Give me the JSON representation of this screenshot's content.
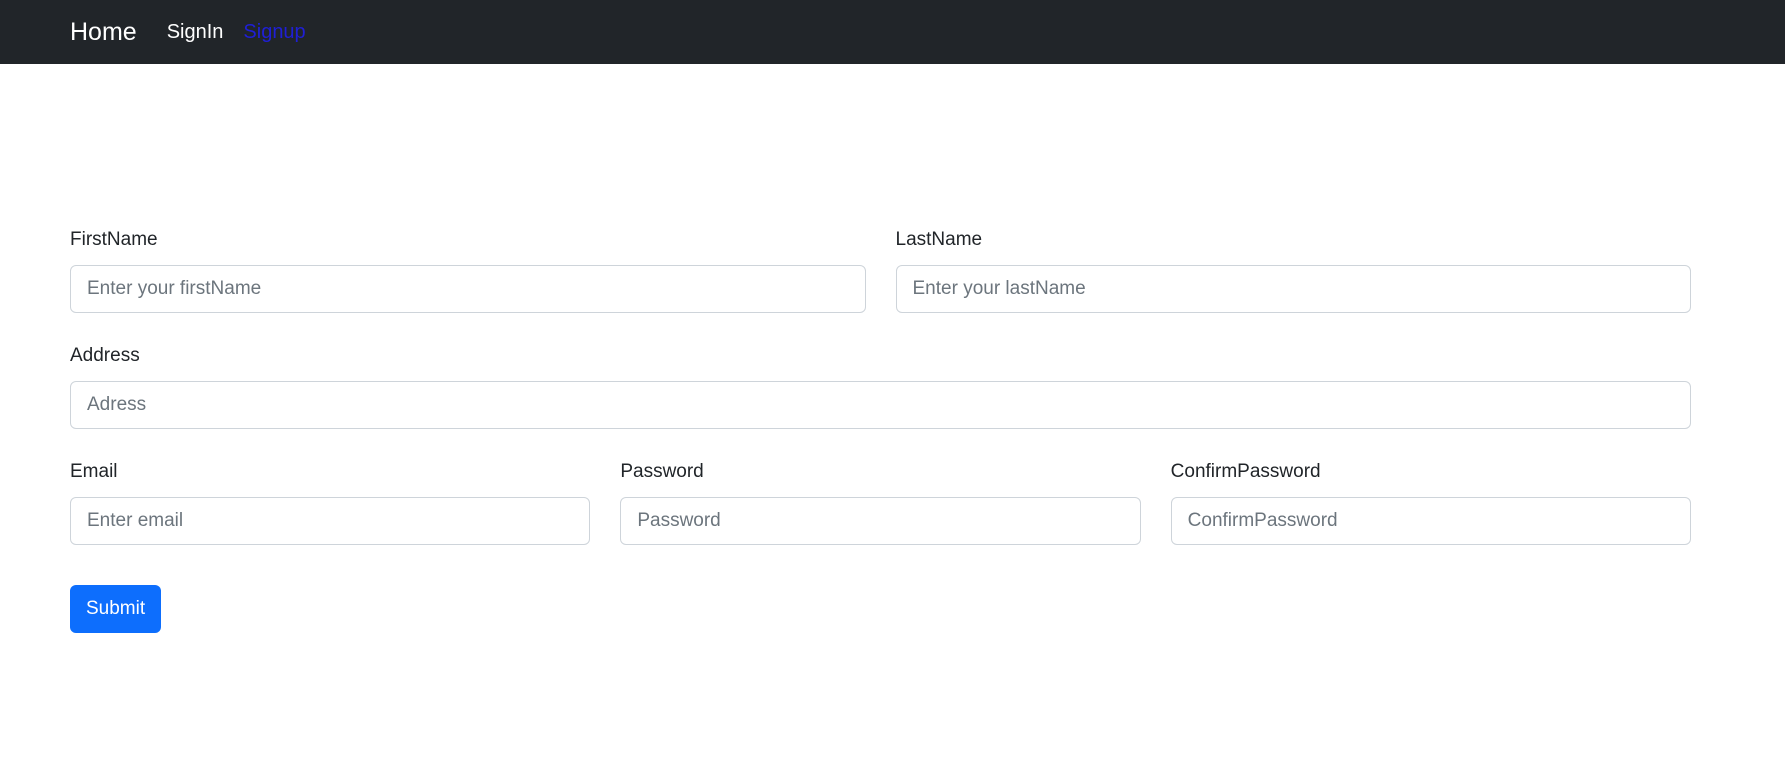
{
  "navbar": {
    "brand": "Home",
    "links": [
      {
        "label": "SignIn"
      },
      {
        "label": "Signup"
      }
    ],
    "colors": {
      "background": "#212529",
      "active_link": "#1f1fd6"
    }
  },
  "form": {
    "first_name": {
      "label": "FirstName",
      "placeholder": "Enter your firstName",
      "value": ""
    },
    "last_name": {
      "label": "LastName",
      "placeholder": "Enter your lastName",
      "value": ""
    },
    "address": {
      "label": "Address",
      "placeholder": "Adress",
      "value": ""
    },
    "email": {
      "label": "Email",
      "placeholder": "Enter email",
      "value": ""
    },
    "password": {
      "label": "Password",
      "placeholder": "Password",
      "value": ""
    },
    "confirm_password": {
      "label": "ConfirmPassword",
      "placeholder": "ConfirmPassword",
      "value": ""
    },
    "submit_label": "Submit",
    "colors": {
      "submit_bg": "#0d6efd"
    }
  }
}
